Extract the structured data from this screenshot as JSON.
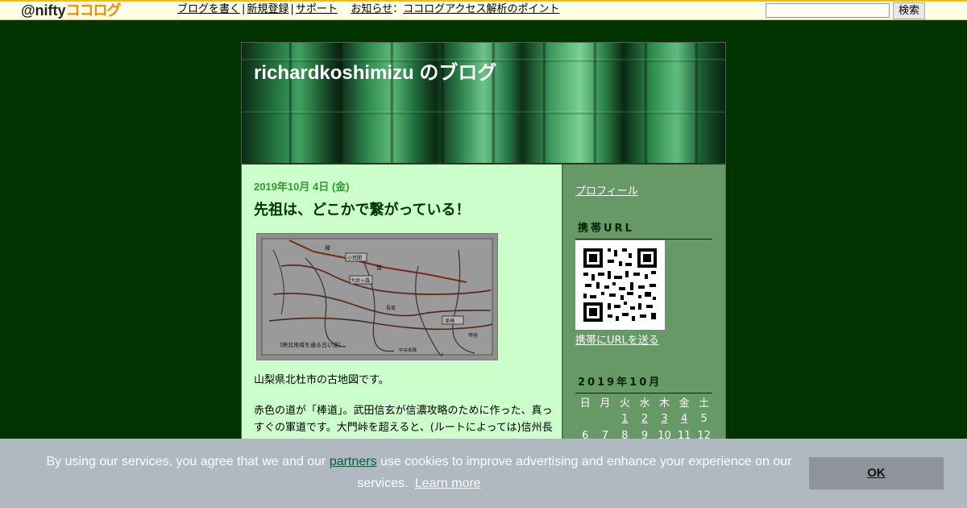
{
  "topbar": {
    "logo_at": "@nifty",
    "logo_brand": "ココログ",
    "links": [
      "ブログを書く",
      "新規登録",
      "サポート"
    ],
    "notice_label": "お知らせ",
    "notice_sep": "：",
    "notice_link": "ココログアクセス解析のポイント",
    "search_placeholder": "",
    "search_button": "検索"
  },
  "blog": {
    "title": "richardkoshimizu のブログ"
  },
  "post": {
    "date": "2019年10月 4日 (金)",
    "title": "先祖は、どこかで繋がっている！",
    "image_caption": "〔峡北地域を通る古い道〕",
    "image_labels": [
      "棒",
      "道",
      "小荒間",
      "大井ヶ森",
      "韮崎",
      "甲府",
      "長坂",
      "中央本線"
    ],
    "paragraph1": "山梨県北杜市の古地図です。",
    "paragraph2": "赤色の道が「棒道」。武田信玄が信濃攻略のために作った、真っすぐの軍道です。大門峠を超えると、(ルートによっては)信州長和町に到達します。RKは、今そこに住んでいます。お城で"
  },
  "sidebar": {
    "profile_link": "プロフィール",
    "mobile_heading": "携帯URL",
    "mobile_link": "携帯にURLを送る",
    "calendar_heading": "2019年10月",
    "weekdays": [
      "日",
      "月",
      "火",
      "水",
      "木",
      "金",
      "土"
    ],
    "weeks": [
      [
        "",
        "",
        "1",
        "2",
        "3",
        "4",
        "5"
      ],
      [
        "6",
        "7",
        "8",
        "9",
        "10",
        "11",
        "12"
      ]
    ],
    "linked_days": [
      "1",
      "2",
      "3",
      "4"
    ]
  },
  "cookie": {
    "text_before": "By using our services, you agree that we and our",
    "partners_link": "partners",
    "text_after": "use cookies to improve advertising and enhance your experience on our services.",
    "learn_more": "Learn more",
    "ok_button": "OK"
  }
}
